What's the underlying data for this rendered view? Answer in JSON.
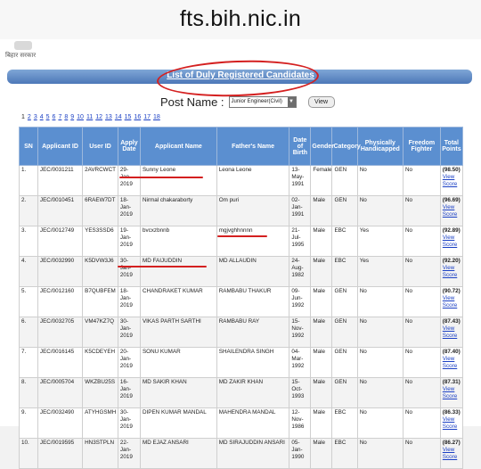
{
  "browser": {
    "url": "fts.bih.nic.in"
  },
  "header": {
    "logo_text": "बिहार सरकार",
    "title": "List of Duly Registered Candidates"
  },
  "filter": {
    "post_label": "Post Name :",
    "post_value": "Junior Engineer(Civil)",
    "view_button": "View"
  },
  "pagination": {
    "pages": [
      "1",
      "2",
      "3",
      "4",
      "5",
      "6",
      "7",
      "8",
      "9",
      "10",
      "11",
      "12",
      "13",
      "14",
      "15",
      "16",
      "17",
      "18"
    ],
    "current": "1"
  },
  "table": {
    "columns": [
      "SN",
      "Applicant ID",
      "User ID",
      "Apply Date",
      "Applicant Name",
      "Father's Name",
      "Date of Birth",
      "Gender",
      "Category",
      "Physically Handicapped",
      "Freedom Fighter",
      "Total Points"
    ],
    "view_score_label": "View Score",
    "rows": [
      {
        "sn": "1.",
        "applicant_id": "JEC/0031211",
        "user_id": "2AVRCWCT",
        "apply_date": "29-Jan-2019",
        "name": "Sunny Leone",
        "father": "Leona Leone",
        "dob": "13-May-1991",
        "gender": "Female",
        "category": "GEN",
        "ph": "No",
        "ff": "No",
        "points": "(98.50)"
      },
      {
        "sn": "2.",
        "applicant_id": "JEC/0010451",
        "user_id": "6RAEW7DT",
        "apply_date": "18-Jan-2019",
        "name": "Nirmal chakaraborty",
        "father": "Om puri",
        "dob": "02-Jan-1991",
        "gender": "Male",
        "category": "GEN",
        "ph": "No",
        "ff": "No",
        "points": "(96.69)"
      },
      {
        "sn": "3.",
        "applicant_id": "JEC/0012749",
        "user_id": "YES3SSD6",
        "apply_date": "19-Jan-2019",
        "name": "bvcxzbnnb",
        "father": "mgjvghhnnnn",
        "dob": "21-Jul-1995",
        "gender": "Male",
        "category": "EBC",
        "ph": "Yes",
        "ff": "No",
        "points": "(92.89)"
      },
      {
        "sn": "4.",
        "applicant_id": "JEC/0032990",
        "user_id": "K5DVW3J6",
        "apply_date": "30-Jan-2019",
        "name": "MD FAIJUDDIN",
        "father": "MD ALLAUDIN",
        "dob": "24-Aug-1982",
        "gender": "Male",
        "category": "EBC",
        "ph": "Yes",
        "ff": "No",
        "points": "(92.20)"
      },
      {
        "sn": "5.",
        "applicant_id": "JEC/0012160",
        "user_id": "B7QUBFEM",
        "apply_date": "18-Jan-2019",
        "name": "CHANDRAKET KUMAR",
        "father": "RAMBABU THAKUR",
        "dob": "09-Jun-1992",
        "gender": "Male",
        "category": "GEN",
        "ph": "No",
        "ff": "No",
        "points": "(90.72)"
      },
      {
        "sn": "6.",
        "applicant_id": "JEC/0032705",
        "user_id": "VM47KZ7Q",
        "apply_date": "30-Jan-2019",
        "name": "VIKAS PARTH SARTHI",
        "father": "RAMBABU RAY",
        "dob": "15-Nov-1992",
        "gender": "Male",
        "category": "GEN",
        "ph": "No",
        "ff": "No",
        "points": "(87.43)"
      },
      {
        "sn": "7.",
        "applicant_id": "JEC/0016145",
        "user_id": "K5CDEYEH",
        "apply_date": "20-Jan-2019",
        "name": "SONU KUMAR",
        "father": "SHAILENDRA SINGH",
        "dob": "04-Mar-1992",
        "gender": "Male",
        "category": "GEN",
        "ph": "No",
        "ff": "No",
        "points": "(87.40)"
      },
      {
        "sn": "8.",
        "applicant_id": "JEC/0005704",
        "user_id": "WKZBU25S",
        "apply_date": "16-Jan-2019",
        "name": "MD SAKIR KHAN",
        "father": "MD ZAKIR KHAN",
        "dob": "15-Oct-1993",
        "gender": "Male",
        "category": "GEN",
        "ph": "No",
        "ff": "No",
        "points": "(87.31)"
      },
      {
        "sn": "9.",
        "applicant_id": "JEC/0032490",
        "user_id": "ATYHGSMH",
        "apply_date": "30-Jan-2019",
        "name": "DIPEN KUMAR MANDAL",
        "father": "MAHENDRA MANDAL",
        "dob": "12-Nov-1986",
        "gender": "Male",
        "category": "EBC",
        "ph": "No",
        "ff": "No",
        "points": "(86.33)"
      },
      {
        "sn": "10.",
        "applicant_id": "JEC/0019595",
        "user_id": "HN3STPLN",
        "apply_date": "22-Jan-2019",
        "name": "MD EJAZ ANSARI",
        "father": "MD SIRAJUDDIN ANSARI",
        "dob": "05-Jan-1990",
        "gender": "Male",
        "category": "EBC",
        "ph": "No",
        "ff": "No",
        "points": "(86.27)"
      }
    ]
  },
  "colors": {
    "header_blue": "#5b8fd0",
    "annotation_red": "#d42020",
    "link_blue": "#1a3fc4"
  }
}
